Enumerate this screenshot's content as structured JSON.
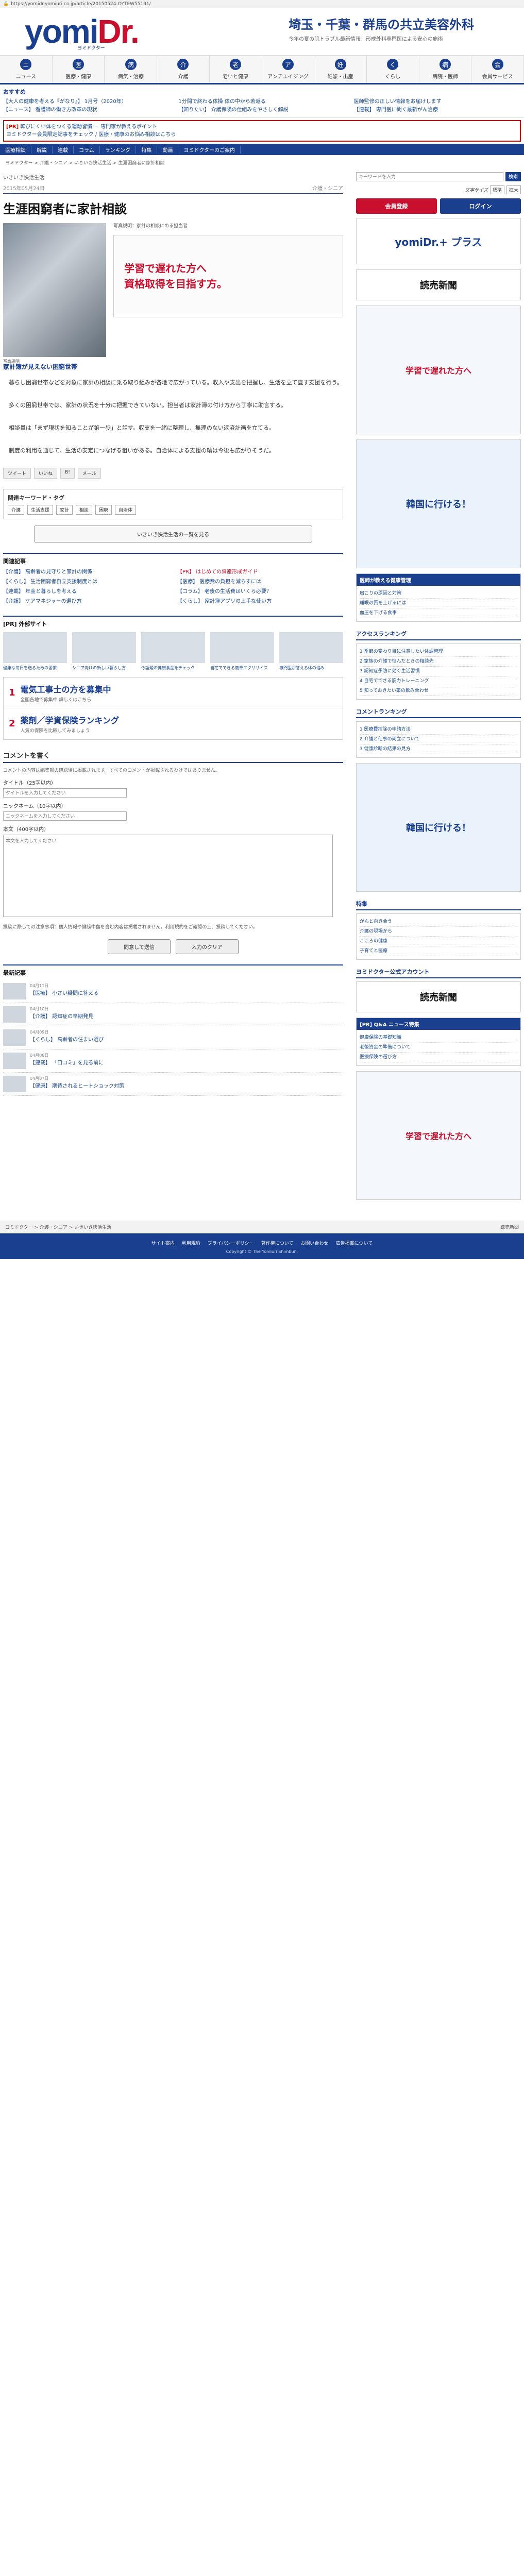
{
  "browser": {
    "url": "https://yomidr.yomiuri.co.jp/article/20150524-OYTEW55191/"
  },
  "header": {
    "logo_main": "yomi",
    "logo_accent": "Dr.",
    "logo_tagline": "ヨミドクター",
    "ad_title": "埼玉・千葉・群馬の共立美容外科",
    "ad_sub": "今年の夏の肌トラブル最新情報！形成外科専門医による安心の施術"
  },
  "nav": [
    {
      "icon": "ニ",
      "label": "ニュース"
    },
    {
      "icon": "医",
      "label": "医療・健康"
    },
    {
      "icon": "病",
      "label": "病気・治療"
    },
    {
      "icon": "介",
      "label": "介護"
    },
    {
      "icon": "老",
      "label": "老いと健康"
    },
    {
      "icon": "ア",
      "label": "アンチエイジング"
    },
    {
      "icon": "妊",
      "label": "妊娠・出産"
    },
    {
      "icon": "く",
      "label": "くらし"
    },
    {
      "icon": "病",
      "label": "病院・医師"
    },
    {
      "icon": "会",
      "label": "会員サービス"
    }
  ],
  "osusume": {
    "heading": "おすすめ",
    "items": [
      "【大人の健康を考える『がなり』】 1月号（2020年）",
      "1分間で終わる体操 体の中から若返る",
      "医師監修の正しい情報をお届けします",
      "【ニュース】 看護師の働き方改革の現状",
      "【知りたい】 介護保険の仕組みをやさしく解説",
      "【連載】 専門医に聞く最新がん治療"
    ]
  },
  "alert": {
    "tag": "[PR]",
    "text1": "転びにくい体をつくる運動習慣 — 専門家が教えるポイント",
    "text2": "ヨミドクター会員限定記事をチェック",
    "text3": "医療・健康のお悩み相談はこちら"
  },
  "subnav": [
    "医療相談",
    "解説",
    "連載",
    "コラム",
    "ランキング",
    "特集",
    "動画",
    "ヨミドクターのご案内"
  ],
  "breadcrumb": "ヨミドクター > 介護・シニア > いきいき快活生活 > 生涯困窮者に家計相談",
  "article": {
    "category": "いきいき快活生活",
    "date": "2015年05月24日",
    "section": "介護・シニア",
    "title": "生涯困窮者に家計相談",
    "photo_caption": "写真説明",
    "photo_desc": "写真説明：家計の相談にのる担当者",
    "ad_lines": [
      "学習で遅れた方へ",
      "資格取得を目指す方。"
    ],
    "subhead": "家計簿が見えない困窮世帯",
    "paragraphs": [
      "暮らし困窮世帯などを対象に家計の相談に乗る取り組みが各地で広がっている。収入や支出を把握し、生活を立て直す支援を行う。",
      "多くの困窮世帯では、家計の状況を十分に把握できていない。担当者は家計簿の付け方から丁寧に助言する。",
      "相談員は「まず現状を知ることが第一歩」と話す。収支を一緒に整理し、無理のない返済計画を立てる。",
      "制度の利用を通じて、生活の安定につなげる狙いがある。自治体による支援の輪は今後も広がりそうだ。"
    ],
    "share": [
      "ツイート",
      "いいね",
      "B!",
      "メール"
    ]
  },
  "keywords": {
    "heading": "関連キーワード・タグ",
    "tags": [
      "介護",
      "生活支援",
      "家計",
      "相談",
      "困窮",
      "自治体"
    ]
  },
  "more_label": "いきいき快活生活の一覧を見る",
  "related": {
    "heading": "関連記事",
    "items": [
      "【介護】 高齢者の見守りと家計の関係",
      "【PR】 はじめての資産形成ガイド",
      "【くらし】 生活困窮者自立支援制度とは",
      "【医療】 医療費の負担を減らすには",
      "【連載】 年金と暮らしを考える",
      "【コラム】 老後の生活費はいくら必要？",
      "【介護】 ケアマネジャーの選び方",
      "【くらし】 家計簿アプリの上手な使い方"
    ]
  },
  "pr": {
    "heading": "[PR] 外部サイト",
    "thumbs": [
      "健康な毎日を送るための習慣",
      "シニア向けの新しい暮らし方",
      "今話題の健康食品をチェック",
      "自宅でできる簡単エクササイズ",
      "専門医が答える体の悩み"
    ]
  },
  "ranking": [
    {
      "n": "1",
      "title": "電気工事士の方を募集中",
      "sub": "全国各地で募集中 詳しくはこちら"
    },
    {
      "n": "2",
      "title": "薬剤／学資保険ランキング",
      "sub": "人気の保険を比較してみましょう"
    }
  ],
  "comment": {
    "heading": "コメントを書く",
    "note": "コメントの内容は編集部の確認後に掲載されます。すべてのコメントが掲載されるわけではありません。",
    "title_label": "タイトル（25字以内）",
    "title_ph": "タイトルを入力してください",
    "nick_label": "ニックネーム（10字以内）",
    "nick_ph": "ニックネームを入力してください",
    "body_label": "本文（400字以内）",
    "body_ph": "本文を入力してください",
    "guide": "投稿に際しての注意事項：個人情報や誹謗中傷を含む内容は掲載されません。利用規約をご確認の上、投稿してください。",
    "submit": "同意して送信",
    "cancel": "入力のクリア"
  },
  "newest": {
    "heading": "最新記事",
    "items": [
      {
        "date": "04月11日",
        "title": "【医療】 小さい疑問に答える"
      },
      {
        "date": "04月10日",
        "title": "【介護】 認知症の早期発見"
      },
      {
        "date": "04月09日",
        "title": "【くらし】 高齢者の住まい選び"
      },
      {
        "date": "04月08日",
        "title": "【連載】 「口コミ」を見る前に"
      },
      {
        "date": "04月07日",
        "title": "【健康】 期待されるヒートショック対策"
      }
    ]
  },
  "sidebar": {
    "search_ph": "キーワードを入力",
    "search_btn": "検索",
    "font_label": "文字サイズ",
    "font_small": "標準",
    "font_big": "拡大",
    "register": "会員登録",
    "login": "ログイン",
    "banner1": "yomiDr.+ プラス",
    "banner2": "読売新聞",
    "banner3": "学習で遅れた方へ",
    "banner4": "韓国に行ける！",
    "box1_h": "医師が教える健康管理",
    "box1_items": [
      "肩こりの原因と対策",
      "睡眠の質を上げるには",
      "血圧を下げる食事"
    ],
    "sec_access": "アクセスランキング",
    "access_items": [
      "1 季節の変わり目に注意したい体調管理",
      "2 家族の介護で悩んだときの相談先",
      "3 認知症予防に効く生活習慣",
      "4 自宅でできる筋力トレーニング",
      "5 知っておきたい薬の飲み合わせ"
    ],
    "sec_rank2": "コメントランキング",
    "rank2_items": [
      "1 医療費控除の申請方法",
      "2 介護と仕事の両立について",
      "3 健康診断の結果の見方"
    ],
    "sec_special": "特集",
    "special_items": [
      "がんと向き合う",
      "介護の現場から",
      "こころの健康",
      "子育てと医療"
    ],
    "sec_tags": "ヨミドクター公式アカウント",
    "qa_h": "[PR] Q&A ニュース特集",
    "qa_items": [
      "健康保険の基礎知識",
      "老後資金の準備について",
      "医療保険の選び方"
    ]
  },
  "footer": {
    "crumb": "ヨミドクター > 介護・シニア > いきいき快活生活",
    "brand": "読売新聞",
    "links": [
      "サイト案内",
      "利用規約",
      "プライバシーポリシー",
      "著作権について",
      "お問い合わせ",
      "広告掲載について"
    ],
    "copy": "Copyright © The Yomiuri Shimbun."
  }
}
